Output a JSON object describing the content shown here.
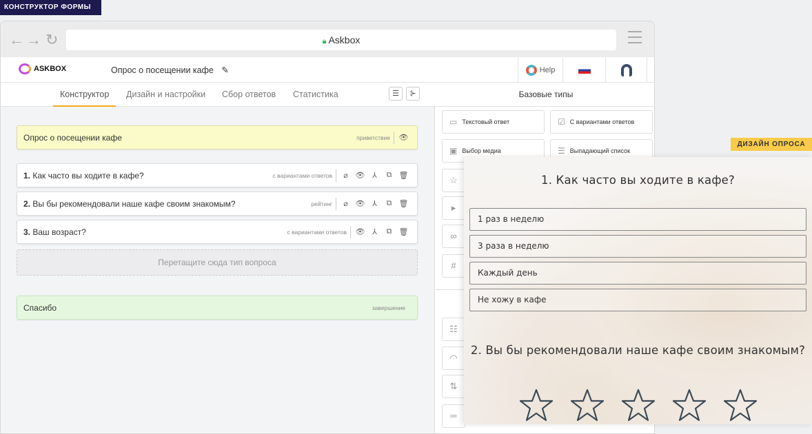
{
  "badges": {
    "builder": "КОНСТРУКТОР ФОРМЫ",
    "design": "ДИЗАЙН ОПРОСА"
  },
  "browser": {
    "url_title": "Askbox"
  },
  "app": {
    "logo": "ASKBOX",
    "survey_title": "Опрос о посещении кафе",
    "help": "Help"
  },
  "tabs": [
    {
      "label": "Конструктор",
      "active": true
    },
    {
      "label": "Дизайн и настройки"
    },
    {
      "label": "Сбор ответов"
    },
    {
      "label": "Статистика"
    }
  ],
  "welcome": {
    "title": "Опрос о посещении кафе",
    "type": "приветствие"
  },
  "questions": [
    {
      "num": "1.",
      "title": "Как часто вы ходите в кафе?",
      "type": "с вариантами ответов"
    },
    {
      "num": "2.",
      "title": "Вы бы рекомендовали наше кафе своим знакомым?",
      "type": "рейтинг"
    },
    {
      "num": "3.",
      "title": "Ваш возраст?",
      "type": "с вариантами ответов"
    }
  ],
  "drop_zone": "Перетащите сюда тип вопроса",
  "ending": {
    "title": "Спасибо",
    "type": "завершение"
  },
  "right_panel": {
    "header": "Базовые типы",
    "types": [
      "Текстовый ответ",
      "С вариантами ответов",
      "Выбор медиа",
      "Выпадающий список"
    ]
  },
  "preview": {
    "q1": "1. Как часто вы ходите в кафе?",
    "options": [
      "1 раз в неделю",
      "3 раза в неделю",
      "Каждый день",
      "Не хожу в кафе"
    ],
    "q2": "2. Вы бы рекомендовали наше кафе своим знакомым?",
    "stars_total": 5,
    "stars_selected": 0
  }
}
